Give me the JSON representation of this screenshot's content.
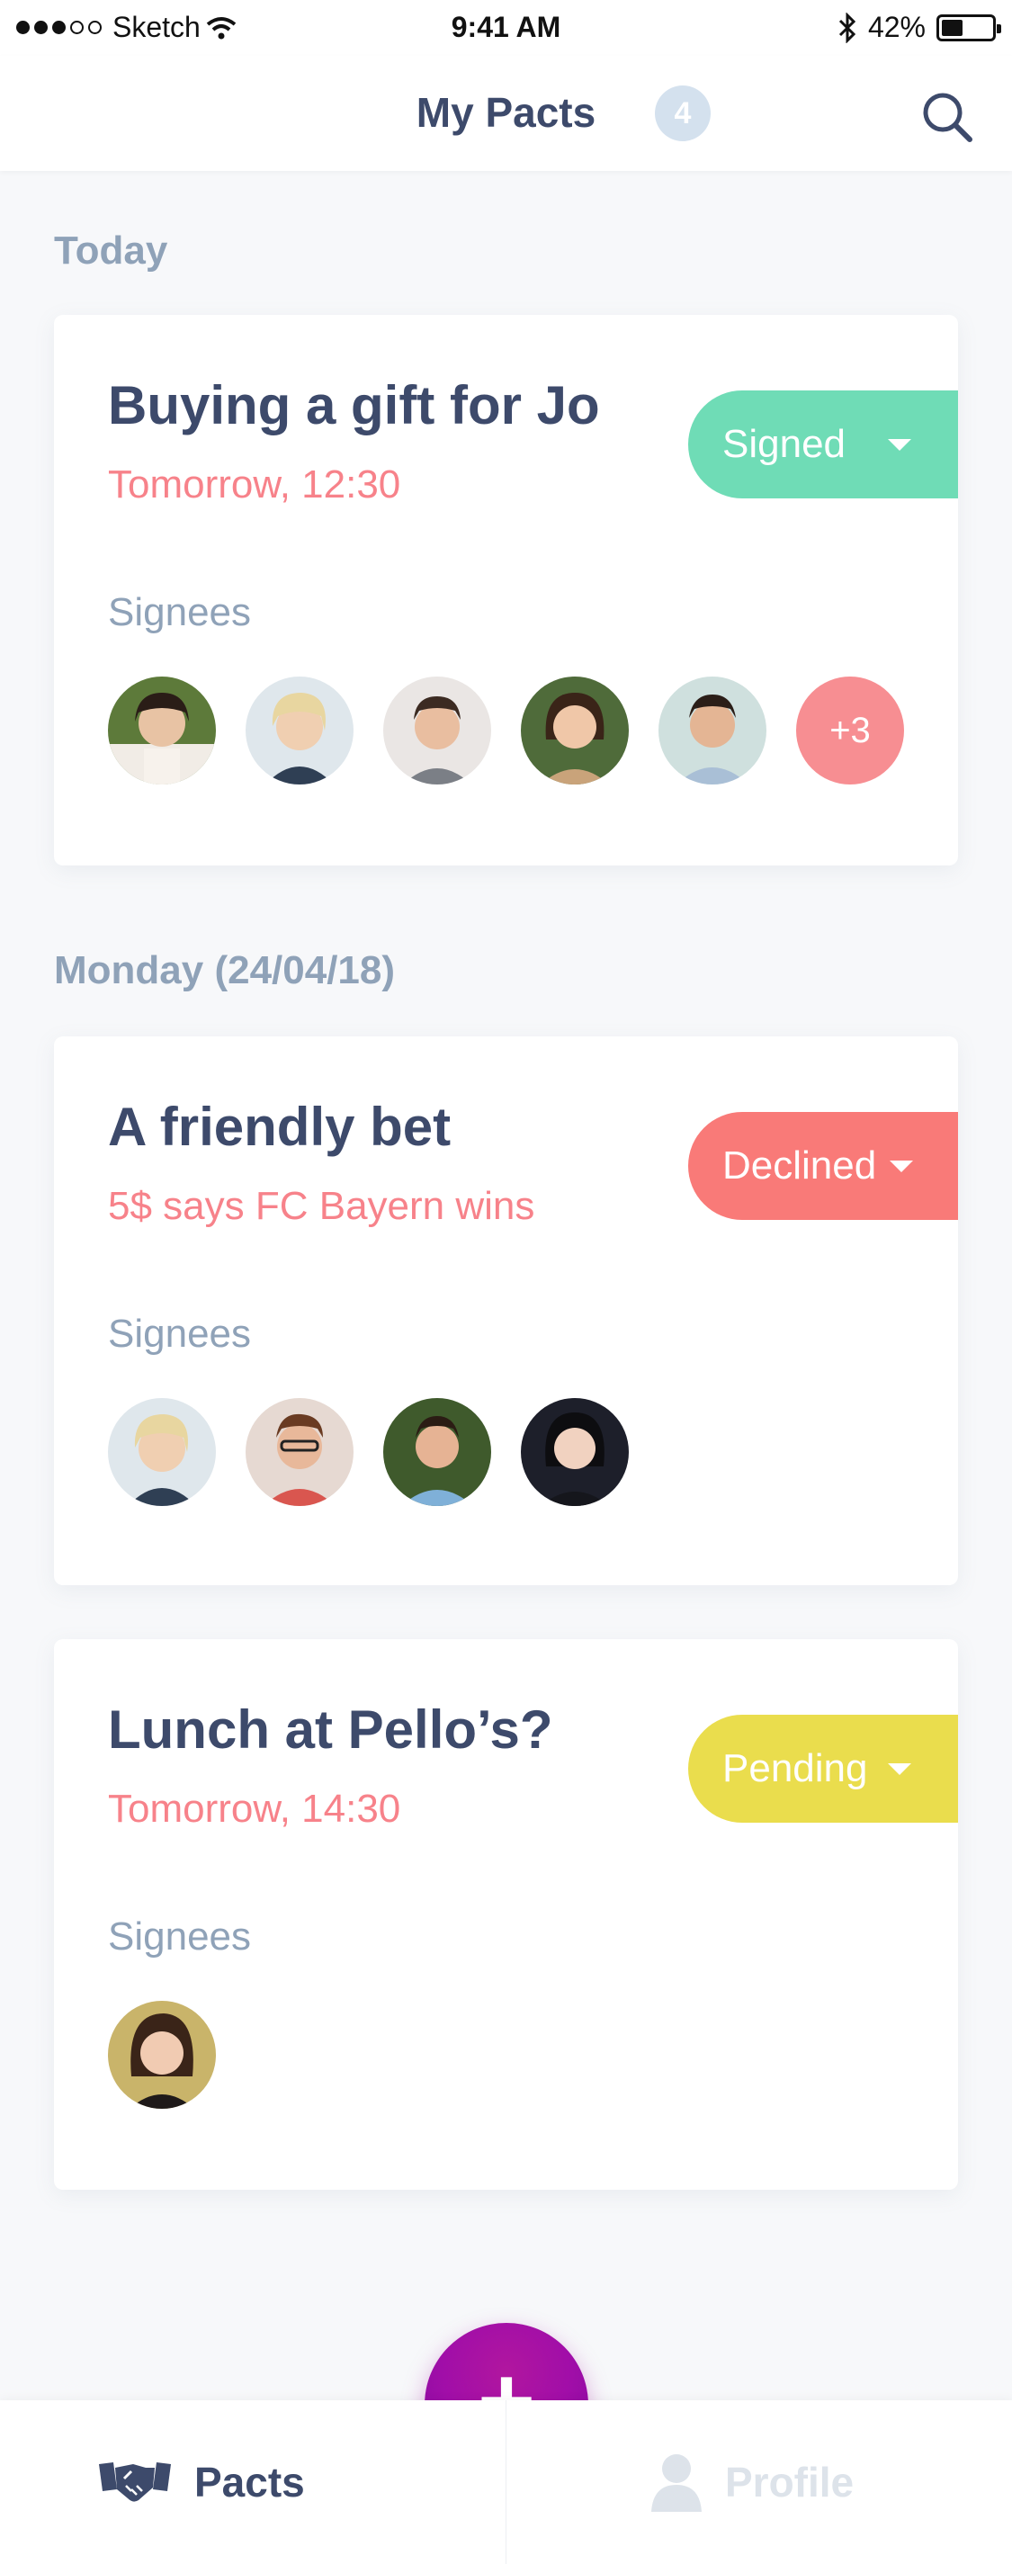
{
  "status_bar": {
    "carrier": "Sketch",
    "time": "9:41 AM",
    "battery": "42%",
    "battery_level": 0.42
  },
  "header": {
    "title": "My Pacts",
    "count": "4"
  },
  "sections": [
    {
      "label": "Today"
    },
    {
      "label": "Monday (24/04/18)"
    }
  ],
  "pacts": [
    {
      "title": "Buying a gift for Jo",
      "subtitle": "Tomorrow, 12:30",
      "status": "Signed",
      "status_color": "#6fdcb6",
      "signees_label": "Signees",
      "more": "+3"
    },
    {
      "title": "A friendly bet",
      "subtitle": "5$ says FC Bayern wins",
      "status": "Declined",
      "status_color": "#f97a78",
      "signees_label": "Signees"
    },
    {
      "title": "Lunch at Pello’s?",
      "subtitle": "Tomorrow, 14:30",
      "status": "Pending",
      "status_color": "#eadd4d",
      "signees_label": "Signees"
    }
  ],
  "tabs": {
    "pacts": "Pacts",
    "profile": "Profile"
  },
  "fab": {
    "icon": "plus-icon",
    "label": "+"
  },
  "icons": {
    "search": "search-icon",
    "pacts": "handshake-icon",
    "profile": "user-icon",
    "wifi": "wifi-icon",
    "bluetooth": "bluetooth-icon",
    "battery": "battery-icon"
  },
  "colors": {
    "accent": "#a10ea8",
    "title": "#3d4a6b",
    "subtitle": "#f7828a",
    "muted": "#8fa2b8"
  }
}
